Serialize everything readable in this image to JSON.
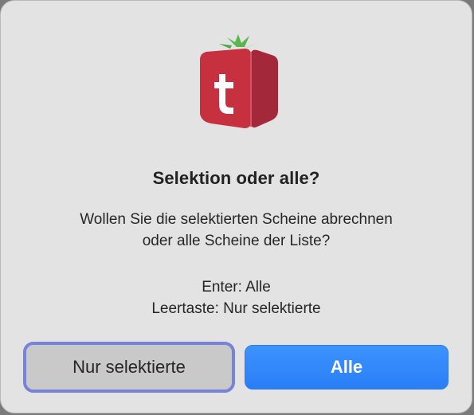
{
  "dialog": {
    "title": "Selektion oder alle?",
    "message_line_1": "Wollen Sie die selektierten Scheine abrechnen",
    "message_line_2": "oder alle Scheine der Liste?",
    "hint_enter": "Enter: Alle",
    "hint_space": "Leertaste: Nur selektierte",
    "logo_icon": "tomato-t-app-icon",
    "logo_letter": "t"
  },
  "buttons": {
    "secondary_label": "Nur selektierte",
    "primary_label": "Alle"
  },
  "colors": {
    "dialog_bg": "#e3e3e3",
    "primary_button": "#2f86fb",
    "focus_ring": "#7783d8",
    "logo_red": "#c7303f",
    "logo_dark_red": "#a3283a",
    "leaf_green": "#4caf50"
  }
}
